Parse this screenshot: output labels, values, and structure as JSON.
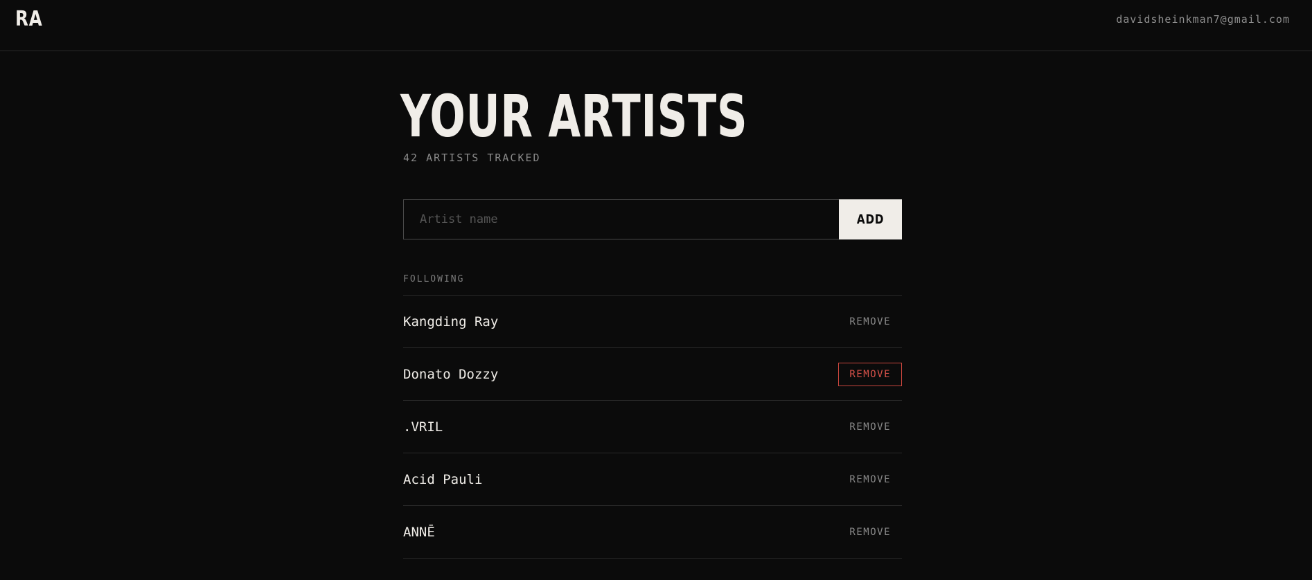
{
  "header": {
    "logo": "RA",
    "user_email": "davidsheinkman7@gmail.com"
  },
  "main": {
    "title": "YOUR ARTISTS",
    "count_text": "42 ARTISTS TRACKED",
    "search": {
      "placeholder": "Artist name",
      "value": ""
    },
    "add_label": "ADD",
    "section_label": "FOLLOWING",
    "remove_label": "REMOVE",
    "artists": [
      {
        "name": "Kangding Ray",
        "remove_hovered": false
      },
      {
        "name": "Donato Dozzy",
        "remove_hovered": true
      },
      {
        "name": ".VRIL",
        "remove_hovered": false
      },
      {
        "name": "Acid Pauli",
        "remove_hovered": false
      },
      {
        "name": "ANNĒ",
        "remove_hovered": false
      }
    ]
  },
  "colors": {
    "background": "#0b0b0b",
    "text": "#f0ede8",
    "muted": "#8a8a8a",
    "divider": "#2a2a2a",
    "danger": "#d9524a"
  }
}
